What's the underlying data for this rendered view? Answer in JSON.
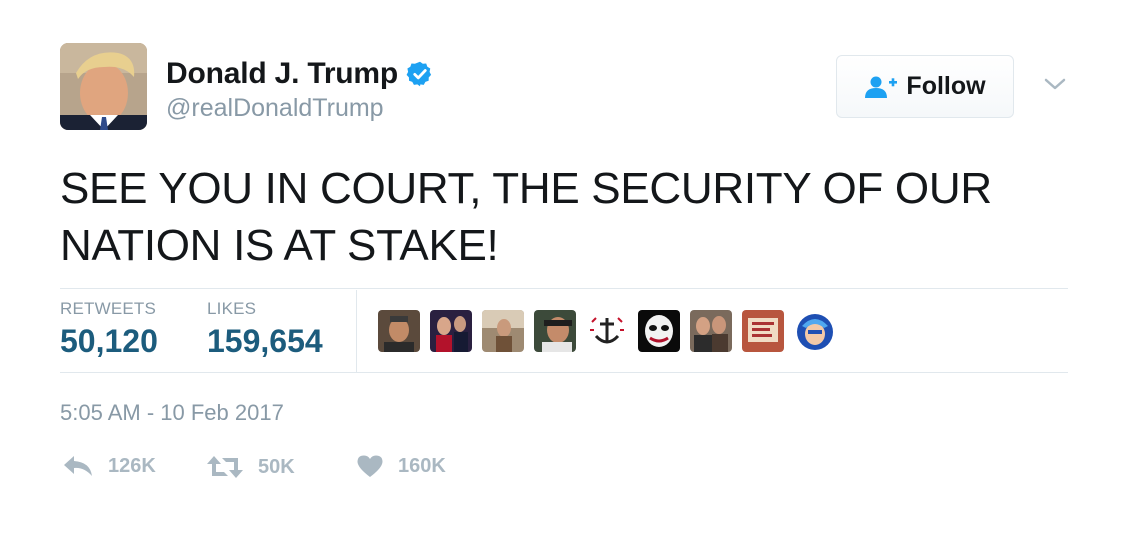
{
  "user": {
    "display_name": "Donald J. Trump",
    "handle": "@realDonaldTrump",
    "verified_icon": "verified-badge-icon",
    "avatar_icon": "profile-photo"
  },
  "follow_button": {
    "label": "Follow",
    "icon": "follow-user-icon"
  },
  "menu": {
    "icon": "chevron-down-icon"
  },
  "tweet": {
    "text": "SEE YOU IN COURT, THE SECURITY OF OUR NATION IS AT STAKE!"
  },
  "stats": {
    "retweets_label": "RETWEETS",
    "retweets_value": "50,120",
    "likes_label": "LIKES",
    "likes_value": "159,654"
  },
  "likers": {
    "count": 9,
    "icon": "liker-avatar"
  },
  "timestamp": "5:05 AM - 10 Feb 2017",
  "actions": {
    "reply_count": "126K",
    "retweet_count": "50K",
    "like_count": "160K",
    "reply_icon": "reply-icon",
    "retweet_icon": "retweet-icon",
    "like_icon": "heart-icon"
  },
  "colors": {
    "verified_blue": "#1da1f2",
    "stat_value": "#1c5c7d",
    "muted": "#8899a6",
    "action_gray": "#aab8c2",
    "divider": "#e1e8ed"
  }
}
